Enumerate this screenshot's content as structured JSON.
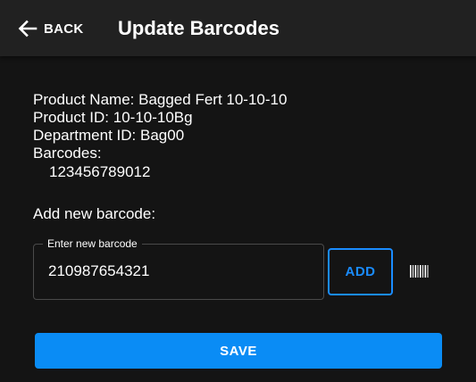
{
  "header": {
    "back_label": "BACK",
    "back_icon": "arrow-left-icon",
    "title": "Update Barcodes",
    "background": "#212121"
  },
  "product": {
    "name_line": "Product Name: Bagged Fert 10-10-10",
    "id_line": "Product ID: 10-10-10Bg",
    "department_line": "Department ID: Bag00",
    "barcodes_label": "Barcodes:",
    "barcodes": [
      "123456789012"
    ]
  },
  "add_barcode": {
    "heading": "Add new barcode:",
    "field_label": "Enter new barcode",
    "field_value": "210987654321",
    "add_label": "ADD",
    "scan_icon": "barcode-scan-icon"
  },
  "actions": {
    "save_label": "SAVE"
  },
  "colors": {
    "background": "#141414",
    "accent": "#0a8cf5",
    "outline_accent": "#1a8cff"
  }
}
